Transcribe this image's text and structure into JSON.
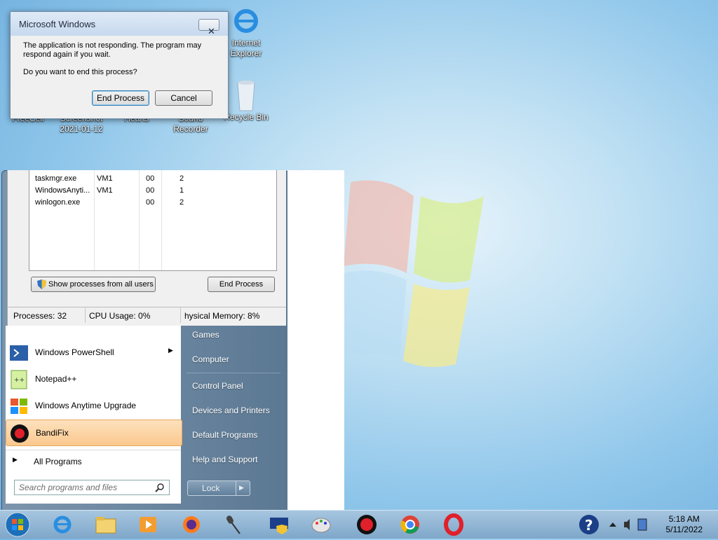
{
  "dialog": {
    "title": "Microsoft Windows",
    "close_glyph": "✕",
    "message": "The application is not responding. The program may respond again if you wait.",
    "question": "Do you want to end this process?",
    "end_process": "End Process",
    "cancel": "Cancel"
  },
  "desktop_icons": {
    "internet_explorer": "Internet Explorer",
    "recycle_bin": "Recycle Bin",
    "freecell": "FreeCell",
    "screenshot": "Screenshot 2021-01-12",
    "hearts": "Hearts",
    "sound_recorder": "Sound Recorder"
  },
  "task_manager": {
    "rows": [
      {
        "name": "taskmgr.exe",
        "user": "VM1",
        "cpu": "00",
        "mem": "2"
      },
      {
        "name": "WindowsAnyti...",
        "user": "VM1",
        "cpu": "00",
        "mem": "1"
      },
      {
        "name": "winlogon.exe",
        "user": "",
        "cpu": "00",
        "mem": "2"
      }
    ],
    "show_all_button": "Show processes from all users",
    "end_process_button": "End Process",
    "processes": "Processes: 32",
    "cpu_usage": "CPU Usage: 0%",
    "physical_memory": "hysical Memory: 8%"
  },
  "start_menu": {
    "left_items": [
      {
        "label": "Windows PowerShell",
        "icon": "powershell-icon"
      },
      {
        "label": "Notepad++",
        "icon": "notepad-plus-plus-icon"
      },
      {
        "label": "Windows Anytime Upgrade",
        "icon": "windows-flag-icon"
      },
      {
        "label": "BandiFix",
        "icon": "bandifix-icon"
      }
    ],
    "all_programs": "All Programs",
    "search_placeholder": "Search programs and files",
    "right_items": {
      "games": "Games",
      "computer": "Computer",
      "control_panel": "Control Panel",
      "devices_printers": "Devices and Printers",
      "default_programs": "Default Programs",
      "help_support": "Help and Support"
    },
    "lock": "Lock",
    "arrow": "▶"
  },
  "taskbar": {
    "time": "5:18 AM",
    "date": "5/11/2022",
    "icons": [
      "start-orb-icon",
      "internet-explorer-icon",
      "file-explorer-icon",
      "media-player-icon",
      "firefox-icon",
      "microphone-icon",
      "windows-security-icon",
      "paint-icon",
      "bandicam-icon",
      "chrome-icon",
      "opera-icon"
    ]
  },
  "colors": {
    "highlight": "#fbc88e",
    "startmenu_right": "#5b7893"
  }
}
